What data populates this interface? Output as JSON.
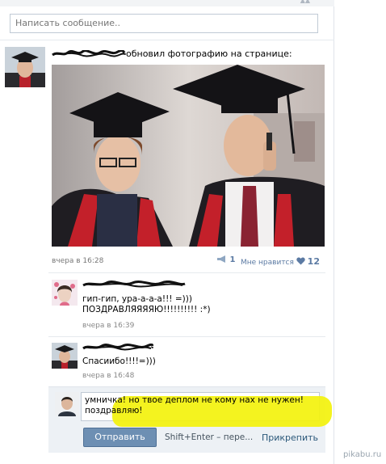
{
  "compose": {
    "placeholder": "Написать сообщение.."
  },
  "post": {
    "author_name": "",
    "action_text": "обновил фотографию на странице:",
    "date": "вчера в 16:28",
    "shares_count": "1",
    "like_label": "Мне нравится",
    "likes_count": "12"
  },
  "comments": [
    {
      "author_name": "",
      "lines": [
        "гип-гип, ура-а-а-а!!! =)))",
        "ПОЗДРАВЛЯЯЯЯЮ!!!!!!!!!! :*)"
      ],
      "date": "вчера в 16:39"
    },
    {
      "author_name": "",
      "lines": [
        "Спасиибо!!!!=)))"
      ],
      "date": "вчера в 16:48"
    }
  ],
  "reply_form": {
    "text_line1": "умничка! но твое деплом не кому нах не нужен!",
    "text_line2": "поздравляю!",
    "send_label": "Отправить",
    "hint": "Shift+Enter – пере...",
    "attach_label": "Прикрепить"
  },
  "watermark": "pikabu.ru",
  "colors": {
    "link": "#2b587a",
    "button": "#6d8fb3",
    "highlight": "#f3f20c",
    "like": "#5b7aa3"
  },
  "icons": [
    "megaphone-icon",
    "heart-icon"
  ]
}
